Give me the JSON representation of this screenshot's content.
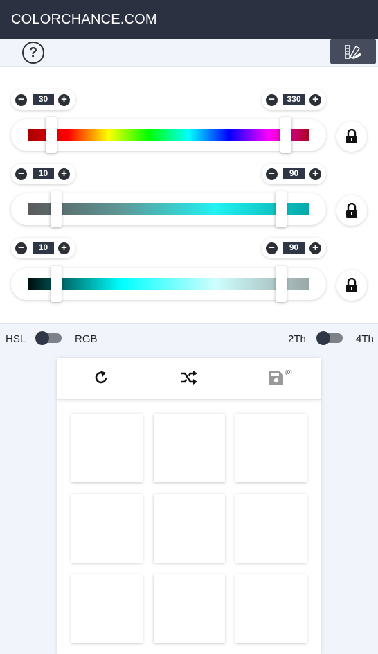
{
  "header": {
    "brand": "COLORCHANCE.COM"
  },
  "toolbar": {
    "help_label": "?"
  },
  "sliders": [
    {
      "name": "hue",
      "min": "30",
      "max": "330",
      "gradient_colors": [
        "#a80000",
        "#ff0000",
        "#ffff00",
        "#00ff00",
        "#00ffff",
        "#0000ff",
        "#ff00ff",
        "#a8001a"
      ]
    },
    {
      "name": "saturation",
      "min": "10",
      "max": "90",
      "gradient_colors": [
        "#5a5a5a",
        "#5e9898",
        "#21f2f2",
        "#05a8a8"
      ]
    },
    {
      "name": "lightness",
      "min": "10",
      "max": "90",
      "gradient_colors": [
        "#000c0c",
        "#00ffff",
        "#cffefe",
        "#9aa6a6"
      ]
    }
  ],
  "mode": {
    "left_label": "HSL",
    "right_label": "RGB"
  },
  "tone": {
    "left_label": "2Th",
    "right_label": "4Th"
  },
  "actions": {
    "save_count": "(0)"
  },
  "icons": [
    "help-icon",
    "palette-icon",
    "minus-icon",
    "plus-icon",
    "lock-icon",
    "refresh-icon",
    "shuffle-icon",
    "save-icon"
  ],
  "swatches": [
    "",
    "",
    "",
    "",
    "",
    "",
    "",
    "",
    ""
  ]
}
